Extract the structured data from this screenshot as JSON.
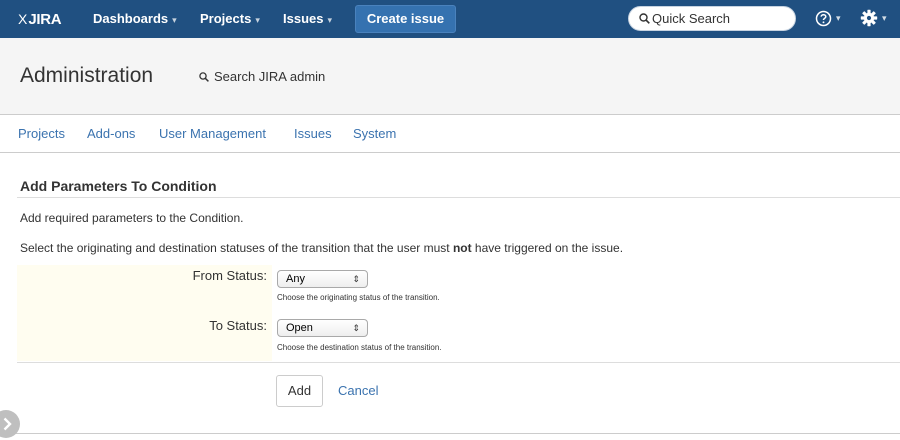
{
  "header": {
    "logo": "JIRA",
    "logo_glyph": "X",
    "nav": [
      {
        "label": "Dashboards",
        "caret": "▾"
      },
      {
        "label": "Projects",
        "caret": "▾"
      },
      {
        "label": "Issues",
        "caret": "▾"
      }
    ],
    "create_label": "Create issue",
    "search_placeholder": "Quick Search",
    "help_caret": "▾",
    "gear_caret": "▾",
    "colors": {
      "bar": "#205081",
      "create": "#3572b0"
    }
  },
  "admin": {
    "title": "Administration",
    "search_label": "Search JIRA admin"
  },
  "tabs": [
    "Projects",
    "Add-ons",
    "User Management",
    "Issues",
    "System"
  ],
  "content": {
    "title": "Add Parameters To Condition",
    "intro": "Add required parameters to the Condition.",
    "desc_before": "Select the originating and destination statuses of the transition that the user must ",
    "desc_bold": "not",
    "desc_after": " have triggered on the issue.",
    "fields": [
      {
        "label": "From Status:",
        "value": "Any",
        "hint": "Choose the originating status of the transition."
      },
      {
        "label": "To Status:",
        "value": "Open",
        "hint": "Choose the destination status of the transition."
      }
    ],
    "select_arrows": "⇕",
    "add_label": "Add",
    "cancel_label": "Cancel"
  }
}
